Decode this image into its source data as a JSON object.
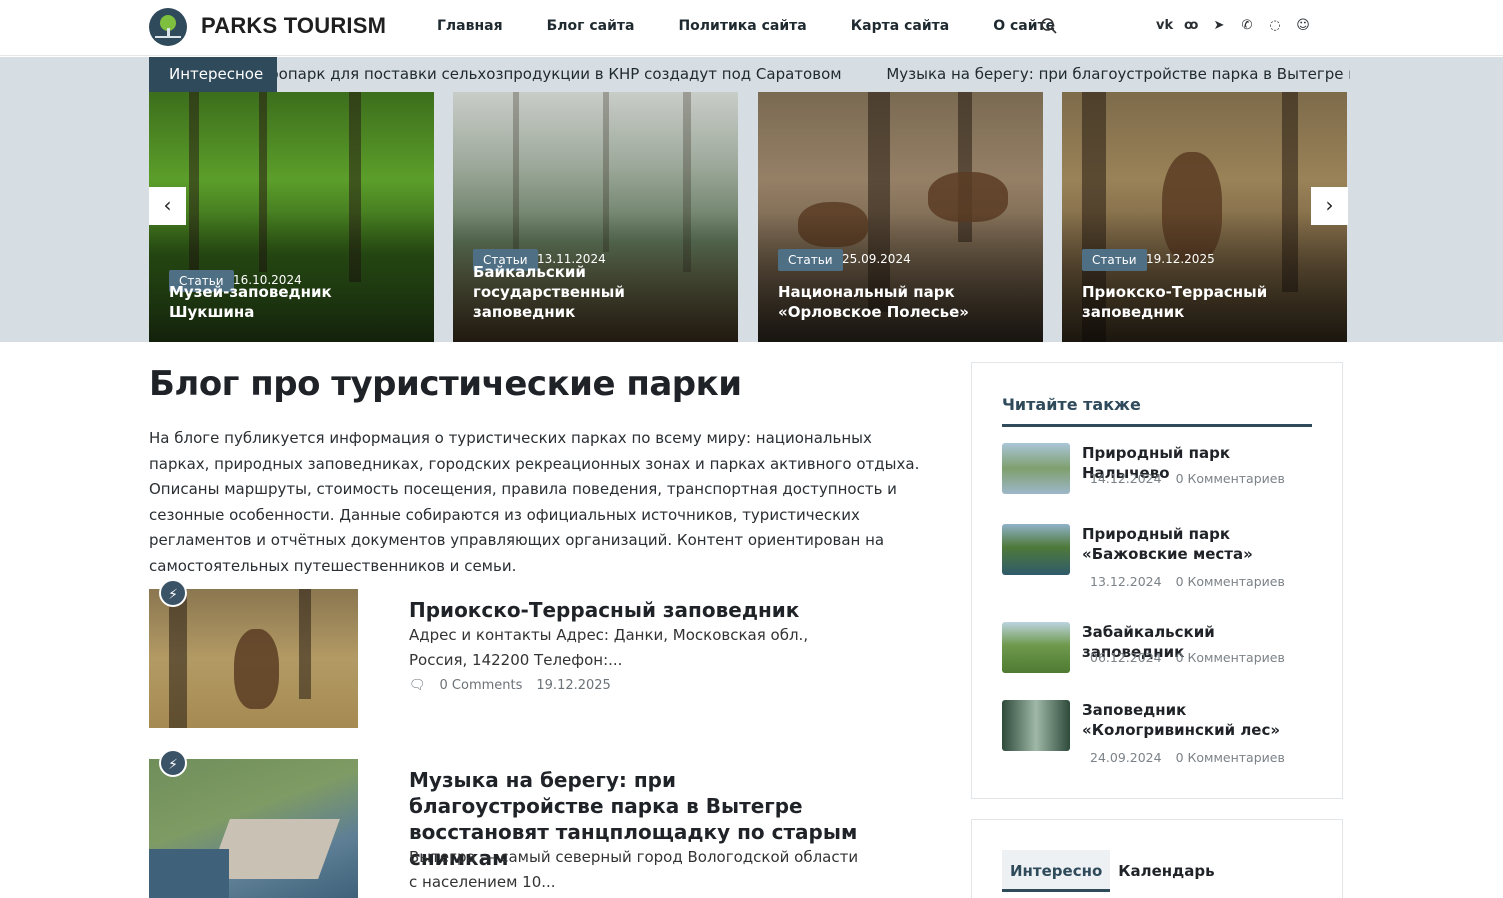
{
  "header": {
    "brand": "PARKS TOURISM",
    "nav": [
      "Главная",
      "Блог сайта",
      "Политика сайта",
      "Карта сайта",
      "О сайте"
    ],
    "icons": [
      "search-icon",
      "vk-icon",
      "ok-icon",
      "telegram-icon",
      "viber-icon",
      "whatsapp-icon",
      "max-icon"
    ],
    "socials": [
      "vk",
      "ok",
      "tg",
      "vb",
      "wa",
      "mx"
    ]
  },
  "ticker": {
    "label": "Интересное",
    "items": [
      "Агропарк для поставки сельхозпродукции в КНР создадут под Саратовом",
      "Музыка на берегу: при благоустройстве парка в Вытегре восстановят танцплощадку по старым снимкам"
    ]
  },
  "slider": {
    "prev": "‹",
    "next": "›",
    "slides": [
      {
        "tag": "Статьи",
        "date": "16.10.2024",
        "title": "Музей-заповедник Шукшина"
      },
      {
        "tag": "Статьи",
        "date": "13.11.2024",
        "title": "Байкальский государственный заповедник"
      },
      {
        "tag": "Статьи",
        "date": "25.09.2024",
        "title": "Национальный парк «Орловское Полесье»"
      },
      {
        "tag": "Статьи",
        "date": "19.12.2025",
        "title": "Приокско-Террасный заповедник"
      }
    ]
  },
  "main": {
    "title": "Блог про туристические парки",
    "intro": "На блоге публикуется информация о туристических парках по всему миру: национальных парках, природных заповедниках, городских рекреационных зонах и парках активного отдыха. Описаны маршруты, стоимость посещения, правила поведения, транспортная доступность и сезонные особенности. Данные собираются из официальных источников, туристических регламентов и отчётных документов управляющих организаций. Контент ориентирован на самостоятельных путешественников и семьи.",
    "posts": [
      {
        "title": "Приокско-Террасный заповедник",
        "excerpt": "Адрес и контакты Адрес: Данки, Московская обл., Россия, 142200 Телефон:...",
        "comments": "0 Comments",
        "date": "19.12.2025"
      },
      {
        "title": "Музыка на берегу: при благоустройстве парка в Вытегре восстановят танцплощадку по старым снимкам",
        "excerpt": "Вытегра — самый северный город Вологодской области с населением 10..."
      }
    ]
  },
  "sidebar": {
    "read_also": {
      "title": "Читайте также",
      "items": [
        {
          "title": "Природный парк Налычево",
          "date": "14.12.2024",
          "comments": "0 Комментариев"
        },
        {
          "title": "Природный парк «Бажовские места»",
          "date": "13.12.2024",
          "comments": "0 Комментариев"
        },
        {
          "title": "Забайкальский заповедник",
          "date": "06.12.2024",
          "comments": "0 Комментариев"
        },
        {
          "title": "Заповедник «Кологривинский лес»",
          "date": "24.09.2024",
          "comments": "0 Комментариев"
        }
      ]
    },
    "tabs": [
      "Интересно",
      "Календарь"
    ]
  },
  "colors": {
    "accent": "#2f4a5b",
    "band": "#d6dee4",
    "tag": "#4f6f84"
  }
}
